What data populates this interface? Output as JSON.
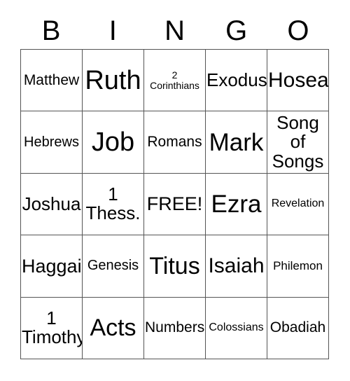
{
  "card": {
    "title": "Bingo Card",
    "headers": [
      "B",
      "I",
      "N",
      "G",
      "O"
    ],
    "free_space_label": "FREE!",
    "colors": {
      "background": "#ffffff",
      "text": "#000000",
      "grid_line": "#555555"
    },
    "rows": [
      [
        {
          "label": "Matthew",
          "size": "fs-xs"
        },
        {
          "label": "Ruth",
          "size": "fs-xl"
        },
        {
          "label": "2\nCorinthians",
          "size": "fs-min"
        },
        {
          "label": "Exodus",
          "size": "fs-s"
        },
        {
          "label": "Hosea",
          "size": "fs-m"
        }
      ],
      [
        {
          "label": "Hebrews",
          "size": "fs-xxs"
        },
        {
          "label": "Job",
          "size": "fs-xl"
        },
        {
          "label": "Romans",
          "size": "fs-xs"
        },
        {
          "label": "Mark",
          "size": "fs-lg"
        },
        {
          "label": "Song\nof\nSongs",
          "size": "fs-s"
        }
      ],
      [
        {
          "label": "Joshua",
          "size": "fs-s"
        },
        {
          "label": "1\nThess.",
          "size": "fs-s"
        },
        {
          "label": "FREE!",
          "size": "fs-ms"
        },
        {
          "label": "Ezra",
          "size": "fs-lg"
        },
        {
          "label": "Revelation",
          "size": "fs-tt"
        }
      ],
      [
        {
          "label": "Haggai",
          "size": "fs-ms"
        },
        {
          "label": "Genesis",
          "size": "fs-xxs"
        },
        {
          "label": "Titus",
          "size": "fs-ml"
        },
        {
          "label": "Isaiah",
          "size": "fs-m"
        },
        {
          "label": "Philemon",
          "size": "fs-t"
        }
      ],
      [
        {
          "label": "1\nTimothy",
          "size": "fs-s"
        },
        {
          "label": "Acts",
          "size": "fs-ml"
        },
        {
          "label": "Numbers",
          "size": "fs-xs"
        },
        {
          "label": "Colossians",
          "size": "fs-tt"
        },
        {
          "label": "Obadiah",
          "size": "fs-xs"
        }
      ]
    ]
  }
}
